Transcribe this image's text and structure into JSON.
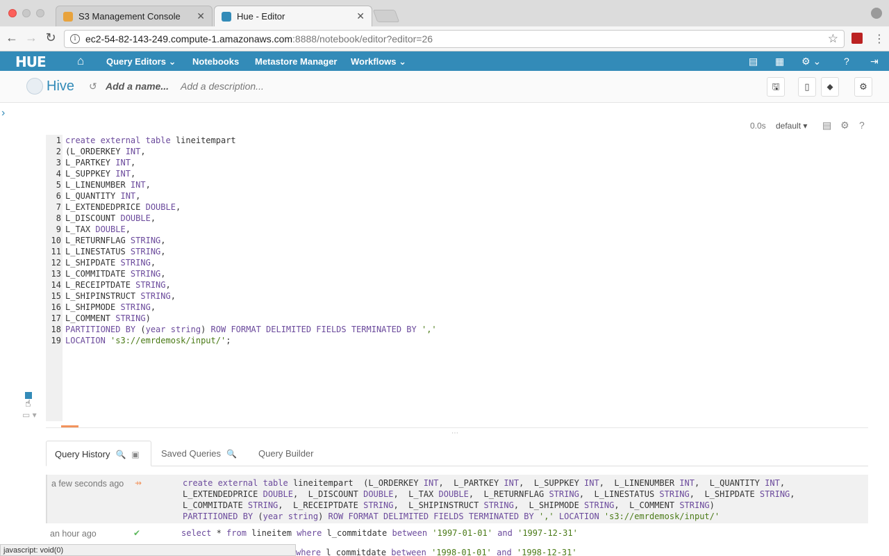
{
  "browser": {
    "tabs": [
      {
        "title": "S3 Management Console",
        "favicon_color": "#e8a33d"
      },
      {
        "title": "Hue - Editor",
        "favicon_color": "#338bb8"
      }
    ],
    "url_host": "ec2-54-82-143-249.compute-1.amazonaws.com",
    "url_path": ":8888/notebook/editor?editor=26",
    "status_text": "javascript: void(0)"
  },
  "hue_nav": {
    "logo": "HUE",
    "items": [
      "Query Editors",
      "Notebooks",
      "Metastore Manager",
      "Workflows"
    ],
    "color": "#338bb8"
  },
  "editor_header": {
    "title": "Hive",
    "name_placeholder": "Add a name...",
    "description_placeholder": "Add a description..."
  },
  "snippet": {
    "exec_time": "0.0s",
    "database": "default"
  },
  "code_lines": [
    {
      "n": "1",
      "segs": [
        [
          "k",
          "create external table "
        ],
        [
          "p",
          "lineitempart"
        ]
      ]
    },
    {
      "n": "2",
      "segs": [
        [
          "p",
          "(L_ORDERKEY "
        ],
        [
          "k",
          "INT"
        ],
        [
          "p",
          ","
        ]
      ]
    },
    {
      "n": "3",
      "segs": [
        [
          "p",
          "L_PARTKEY "
        ],
        [
          "k",
          "INT"
        ],
        [
          "p",
          ","
        ]
      ]
    },
    {
      "n": "4",
      "segs": [
        [
          "p",
          "L_SUPPKEY "
        ],
        [
          "k",
          "INT"
        ],
        [
          "p",
          ","
        ]
      ]
    },
    {
      "n": "5",
      "segs": [
        [
          "p",
          "L_LINENUMBER "
        ],
        [
          "k",
          "INT"
        ],
        [
          "p",
          ","
        ]
      ]
    },
    {
      "n": "6",
      "segs": [
        [
          "p",
          "L_QUANTITY "
        ],
        [
          "k",
          "INT"
        ],
        [
          "p",
          ","
        ]
      ]
    },
    {
      "n": "7",
      "segs": [
        [
          "p",
          "L_EXTENDEDPRICE "
        ],
        [
          "k",
          "DOUBLE"
        ],
        [
          "p",
          ","
        ]
      ]
    },
    {
      "n": "8",
      "segs": [
        [
          "p",
          "L_DISCOUNT "
        ],
        [
          "k",
          "DOUBLE"
        ],
        [
          "p",
          ","
        ]
      ]
    },
    {
      "n": "9",
      "segs": [
        [
          "p",
          "L_TAX "
        ],
        [
          "k",
          "DOUBLE"
        ],
        [
          "p",
          ","
        ]
      ]
    },
    {
      "n": "10",
      "segs": [
        [
          "p",
          "L_RETURNFLAG "
        ],
        [
          "k",
          "STRING"
        ],
        [
          "p",
          ","
        ]
      ]
    },
    {
      "n": "11",
      "segs": [
        [
          "p",
          "L_LINESTATUS "
        ],
        [
          "k",
          "STRING"
        ],
        [
          "p",
          ","
        ]
      ]
    },
    {
      "n": "12",
      "segs": [
        [
          "p",
          "L_SHIPDATE "
        ],
        [
          "k",
          "STRING"
        ],
        [
          "p",
          ","
        ]
      ]
    },
    {
      "n": "13",
      "segs": [
        [
          "p",
          "L_COMMITDATE "
        ],
        [
          "k",
          "STRING"
        ],
        [
          "p",
          ","
        ]
      ]
    },
    {
      "n": "14",
      "segs": [
        [
          "p",
          "L_RECEIPTDATE "
        ],
        [
          "k",
          "STRING"
        ],
        [
          "p",
          ","
        ]
      ]
    },
    {
      "n": "15",
      "segs": [
        [
          "p",
          "L_SHIPINSTRUCT "
        ],
        [
          "k",
          "STRING"
        ],
        [
          "p",
          ","
        ]
      ]
    },
    {
      "n": "16",
      "segs": [
        [
          "p",
          "L_SHIPMODE "
        ],
        [
          "k",
          "STRING"
        ],
        [
          "p",
          ","
        ]
      ]
    },
    {
      "n": "17",
      "segs": [
        [
          "p",
          "L_COMMENT "
        ],
        [
          "k",
          "STRING"
        ],
        [
          "p",
          ")"
        ]
      ]
    },
    {
      "n": "18",
      "segs": [
        [
          "k",
          "PARTITIONED BY "
        ],
        [
          "p",
          "("
        ],
        [
          "k",
          "year string"
        ],
        [
          "p",
          ") "
        ],
        [
          "k",
          "ROW FORMAT DELIMITED FIELDS TERMINATED BY "
        ],
        [
          "s",
          "','"
        ]
      ]
    },
    {
      "n": "19",
      "segs": [
        [
          "k",
          "LOCATION "
        ],
        [
          "s",
          "'s3://emrdemosk/input/'"
        ],
        [
          "p",
          ";"
        ]
      ]
    }
  ],
  "bottom_tabs": [
    "Query History",
    "Saved Queries",
    "Query Builder"
  ],
  "history": [
    {
      "time": "a few seconds ago",
      "status": "running",
      "lines": [
        [
          [
            "k",
            "create external table "
          ],
          [
            "p",
            "lineitempart  (L_ORDERKEY "
          ],
          [
            "k",
            "INT"
          ],
          [
            "p",
            ",  L_PARTKEY "
          ],
          [
            "k",
            "INT"
          ],
          [
            "p",
            ",  L_SUPPKEY "
          ],
          [
            "k",
            "INT"
          ],
          [
            "p",
            ",  L_LINENUMBER "
          ],
          [
            "k",
            "INT"
          ],
          [
            "p",
            ",  L_QUANTITY "
          ],
          [
            "k",
            "INT"
          ],
          [
            "p",
            ","
          ]
        ],
        [
          [
            "p",
            "L_EXTENDEDPRICE "
          ],
          [
            "k",
            "DOUBLE"
          ],
          [
            "p",
            ",  L_DISCOUNT "
          ],
          [
            "k",
            "DOUBLE"
          ],
          [
            "p",
            ",  L_TAX "
          ],
          [
            "k",
            "DOUBLE"
          ],
          [
            "p",
            ",  L_RETURNFLAG "
          ],
          [
            "k",
            "STRING"
          ],
          [
            "p",
            ",  L_LINESTATUS "
          ],
          [
            "k",
            "STRING"
          ],
          [
            "p",
            ",  L_SHIPDATE "
          ],
          [
            "k",
            "STRING"
          ],
          [
            "p",
            ","
          ]
        ],
        [
          [
            "p",
            "L_COMMITDATE "
          ],
          [
            "k",
            "STRING"
          ],
          [
            "p",
            ",  L_RECEIPTDATE "
          ],
          [
            "k",
            "STRING"
          ],
          [
            "p",
            ",  L_SHIPINSTRUCT "
          ],
          [
            "k",
            "STRING"
          ],
          [
            "p",
            ",  L_SHIPMODE "
          ],
          [
            "k",
            "STRING"
          ],
          [
            "p",
            ",  L_COMMENT "
          ],
          [
            "k",
            "STRING"
          ],
          [
            "p",
            ")"
          ]
        ],
        [
          [
            "k",
            "PARTITIONED BY "
          ],
          [
            "p",
            "("
          ],
          [
            "k",
            "year string"
          ],
          [
            "p",
            ") "
          ],
          [
            "k",
            "ROW FORMAT DELIMITED FIELDS TERMINATED BY "
          ],
          [
            "s",
            "','"
          ],
          [
            "k",
            " LOCATION "
          ],
          [
            "s",
            "'s3://emrdemosk/input/'"
          ]
        ]
      ]
    },
    {
      "time": "an hour ago",
      "status": "success",
      "lines": [
        [
          [
            "k",
            "select "
          ],
          [
            "p",
            "* "
          ],
          [
            "k",
            "from "
          ],
          [
            "p",
            "lineitem "
          ],
          [
            "k",
            "where "
          ],
          [
            "p",
            "l_commitdate "
          ],
          [
            "k",
            "between "
          ],
          [
            "s",
            "'1997-01-01'"
          ],
          [
            "k",
            " and "
          ],
          [
            "s",
            "'1997-12-31'"
          ]
        ]
      ]
    },
    {
      "time": "",
      "status": "",
      "lines": [
        [
          [
            "k",
            "where "
          ],
          [
            "p",
            "l_commitdate "
          ],
          [
            "k",
            "between "
          ],
          [
            "s",
            "'1998-01-01'"
          ],
          [
            "k",
            " and "
          ],
          [
            "s",
            "'1998-12-31'"
          ]
        ]
      ]
    }
  ]
}
